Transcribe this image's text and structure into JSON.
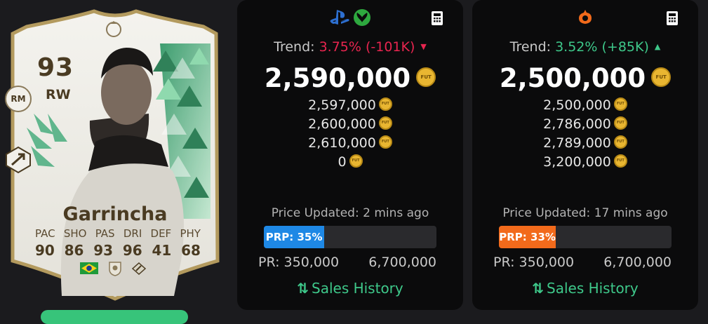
{
  "card": {
    "rating": "93",
    "position": "RW",
    "alt_position": "RM",
    "name": "Garrincha",
    "stat_labels": [
      "PAC",
      "SHO",
      "PAS",
      "DRI",
      "DEF",
      "PHY"
    ],
    "stat_values": [
      "90",
      "86",
      "93",
      "96",
      "41",
      "68"
    ],
    "nation_icon": "brazil-flag",
    "club_icon": "icons-club-badge",
    "playstyle_icon": "playstyle-plus-icon"
  },
  "console_panel": {
    "platform_icons": [
      "playstation-icon",
      "xbox-icon"
    ],
    "trend_label": "Trend:",
    "trend_value": "3.75% (-101K)",
    "trend_direction": "down",
    "main_price": "2,590,000",
    "sub_prices": [
      "2,597,000",
      "2,600,000",
      "2,610,000",
      "0"
    ],
    "updated": "Price Updated: 2 mins ago",
    "prp_label": "PRP: 35%",
    "prp_percent": 35,
    "pr_min": "PR: 350,000",
    "pr_max": "6,700,000",
    "sales_history": "Sales History"
  },
  "pc_panel": {
    "platform_icons": [
      "origin-icon"
    ],
    "trend_label": "Trend:",
    "trend_value": "3.52% (+85K)",
    "trend_direction": "up",
    "main_price": "2,500,000",
    "sub_prices": [
      "2,500,000",
      "2,786,000",
      "2,789,000",
      "3,200,000"
    ],
    "updated": "Price Updated: 17 mins ago",
    "prp_label": "PRP: 33%",
    "prp_percent": 33,
    "pr_min": "PR: 350,000",
    "pr_max": "6,700,000",
    "sales_history": "Sales History"
  },
  "coin_text": "FUT",
  "colors": {
    "trend_down": "#e8254f",
    "trend_up": "#3ec88a",
    "ps_bar": "#1e88e5",
    "pc_bar": "#f26a1b",
    "coin": "#e9b631"
  }
}
